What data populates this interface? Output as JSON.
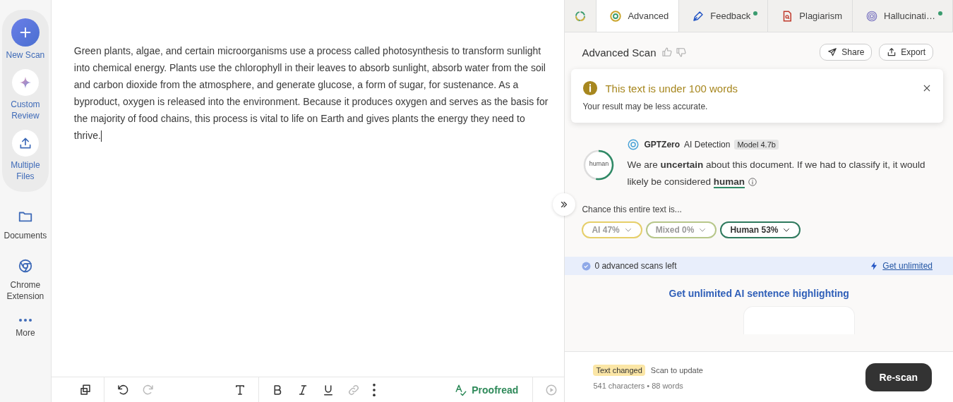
{
  "sidebar": {
    "actions": [
      {
        "kind": "new",
        "label": "New Scan"
      },
      {
        "kind": "review",
        "label": "Custom Review"
      },
      {
        "kind": "upload",
        "label": "Multiple Files"
      }
    ],
    "items": [
      {
        "kind": "folder",
        "label": "Documents"
      },
      {
        "kind": "chrome",
        "label": "Chrome Extension"
      },
      {
        "kind": "more",
        "label": "More"
      }
    ]
  },
  "editor": {
    "text": "Green plants, algae, and certain microorganisms use a process called photosynthesis to transform sunlight into chemical energy. Plants use the chlorophyll in their leaves to absorb sunlight, absorb water from the soil and carbon dioxide from the atmosphere, and generate glucose, a form of sugar, for sustenance. As a byproduct, oxygen is released into the environment. Because it produces oxygen and serves as the basis for the majority of food chains, this process is vital to life on Earth and gives plants the energy they need to thrive.",
    "toolbar": [
      {
        "kind": "copy",
        "disabled": false
      },
      {
        "kind": "sep"
      },
      {
        "kind": "undo",
        "disabled": false
      },
      {
        "kind": "redo",
        "disabled": true
      },
      {
        "kind": "spacer"
      },
      {
        "kind": "text",
        "disabled": false
      },
      {
        "kind": "sep"
      },
      {
        "kind": "bold",
        "disabled": false
      },
      {
        "kind": "italic",
        "disabled": false
      },
      {
        "kind": "underline",
        "disabled": false
      },
      {
        "kind": "link",
        "disabled": true
      },
      {
        "kind": "dots",
        "disabled": false
      },
      {
        "kind": "spacer"
      },
      {
        "kind": "proofread",
        "label": "Proofread"
      },
      {
        "kind": "sep"
      },
      {
        "kind": "play",
        "disabled": true
      }
    ]
  },
  "tabs": [
    {
      "kind": "spinner",
      "selected": false
    },
    {
      "kind": "advanced",
      "label": "Advanced",
      "selected": true,
      "dot": false
    },
    {
      "kind": "feedback",
      "label": "Feedback",
      "selected": false,
      "dot": true
    },
    {
      "kind": "plagiarism",
      "label": "Plagiarism",
      "selected": false,
      "dot": false
    },
    {
      "kind": "hallucination",
      "label": "Hallucinati…",
      "selected": false,
      "dot": true
    }
  ],
  "scan": {
    "title": "Advanced Scan",
    "buttons": [
      {
        "kind": "share",
        "label": "Share"
      },
      {
        "kind": "export",
        "label": "Export"
      }
    ]
  },
  "notice": {
    "title": "This text is under 100 words",
    "message": "Your result may be less accurate."
  },
  "detection": {
    "gauge_label": "human",
    "level": 0.53,
    "brand": "GPTZero",
    "product": "AI Detection",
    "model": "Model 4.7b",
    "summary": "We are **uncertain** about this document. If we had to classify it, it would likely be considered",
    "verdict": "human"
  },
  "chance": {
    "label": "Chance this entire text is...",
    "pills": [
      {
        "kind": "ai",
        "label": "AI 47%",
        "selected": false
      },
      {
        "kind": "mixed",
        "label": "Mixed 0%",
        "selected": false
      },
      {
        "kind": "human",
        "label": "Human 53%",
        "selected": true
      }
    ]
  },
  "quota": {
    "text": "0 advanced scans left",
    "link": "Get unlimited"
  },
  "promo": {
    "title": "Get unlimited AI sentence highlighting"
  },
  "footer": {
    "badge": "Text changed",
    "hint": "Scan to update",
    "stats": "541 characters • 88 words",
    "button": "Re-scan"
  }
}
